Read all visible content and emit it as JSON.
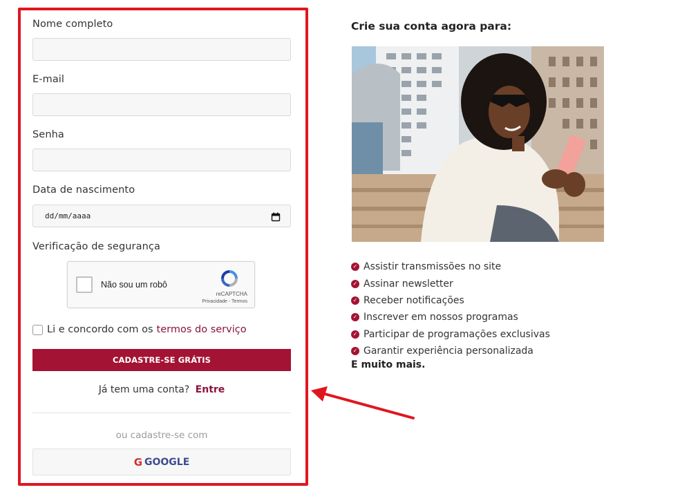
{
  "form": {
    "name_label": "Nome completo",
    "email_label": "E-mail",
    "password_label": "Senha",
    "birthdate_label": "Data de nascimento",
    "birthdate_placeholder": "dd/mm/aaaa",
    "security_label": "Verificação de segurança",
    "captcha": {
      "label": "Não sou um robô",
      "brand": "reCAPTCHA",
      "links": "Privacidade - Termos"
    },
    "terms_text": "Li e concordo com os",
    "terms_link": "termos do serviço",
    "signup_button": "CADASTRE-SE GRÁTIS",
    "login_prompt": "Já tem uma conta?",
    "login_link": "Entre",
    "alt_signup": "ou cadastre-se com",
    "google_icon": "G",
    "google_button": "GOOGLE"
  },
  "side": {
    "title": "Crie sua conta agora para:",
    "benefits": [
      "Assistir transmissões no site",
      "Assinar newsletter",
      "Receber notificações",
      "Inscrever em nossos programas",
      "Participar de programações exclusivas",
      "Garantir experiência personalizada"
    ],
    "more": "E muito mais."
  },
  "colors": {
    "brand": "#a31333",
    "highlight": "#e0161f",
    "link": "#8a1538"
  },
  "icons": {
    "benefit": "check-circle-icon",
    "date": "calendar-icon",
    "captcha": "recaptcha-logo-icon",
    "google": "google-icon",
    "annotation": "arrow-icon"
  }
}
